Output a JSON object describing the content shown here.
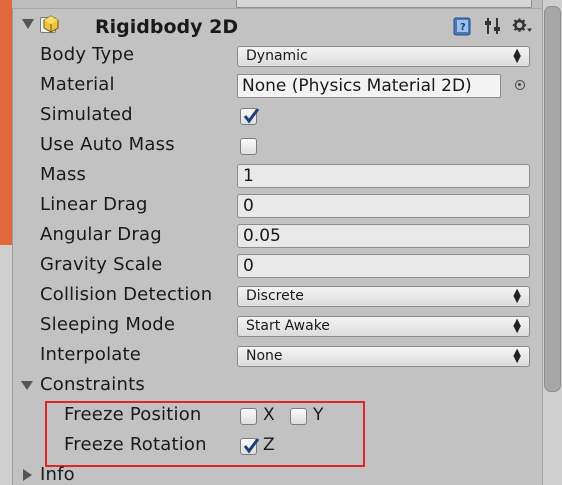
{
  "component": {
    "title": "Rigidbody 2D",
    "enabled": true
  },
  "properties": {
    "body_type": {
      "label": "Body Type",
      "value": "Dynamic"
    },
    "material": {
      "label": "Material",
      "value": "None (Physics Material 2D)"
    },
    "simulated": {
      "label": "Simulated",
      "checked": true
    },
    "use_auto_mass": {
      "label": "Use Auto Mass",
      "checked": false
    },
    "mass": {
      "label": "Mass",
      "value": "1"
    },
    "linear_drag": {
      "label": "Linear Drag",
      "value": "0"
    },
    "angular_drag": {
      "label": "Angular Drag",
      "value": "0.05"
    },
    "gravity_scale": {
      "label": "Gravity Scale",
      "value": "0"
    },
    "collision_detection": {
      "label": "Collision Detection",
      "value": "Discrete"
    },
    "sleeping_mode": {
      "label": "Sleeping Mode",
      "value": "Start Awake"
    },
    "interpolate": {
      "label": "Interpolate",
      "value": "None"
    }
  },
  "constraints": {
    "label": "Constraints",
    "expanded": true,
    "freeze_position": {
      "label": "Freeze Position",
      "x_label": "X",
      "x_checked": false,
      "y_label": "Y",
      "y_checked": false
    },
    "freeze_rotation": {
      "label": "Freeze Rotation",
      "z_label": "Z",
      "z_checked": true
    }
  },
  "info": {
    "label": "Info",
    "expanded": false
  },
  "colors": {
    "panel_bg": "#c2c2c2",
    "highlight_box": "#e0242a",
    "side_accent": "#e0683a"
  },
  "icons": {
    "component": "rigidbody-icon",
    "help": "help-book-icon",
    "preset": "preset-sliders-icon",
    "settings": "gear-icon",
    "picker": "object-picker-icon",
    "dropdown": "dropdown-arrows-icon"
  }
}
